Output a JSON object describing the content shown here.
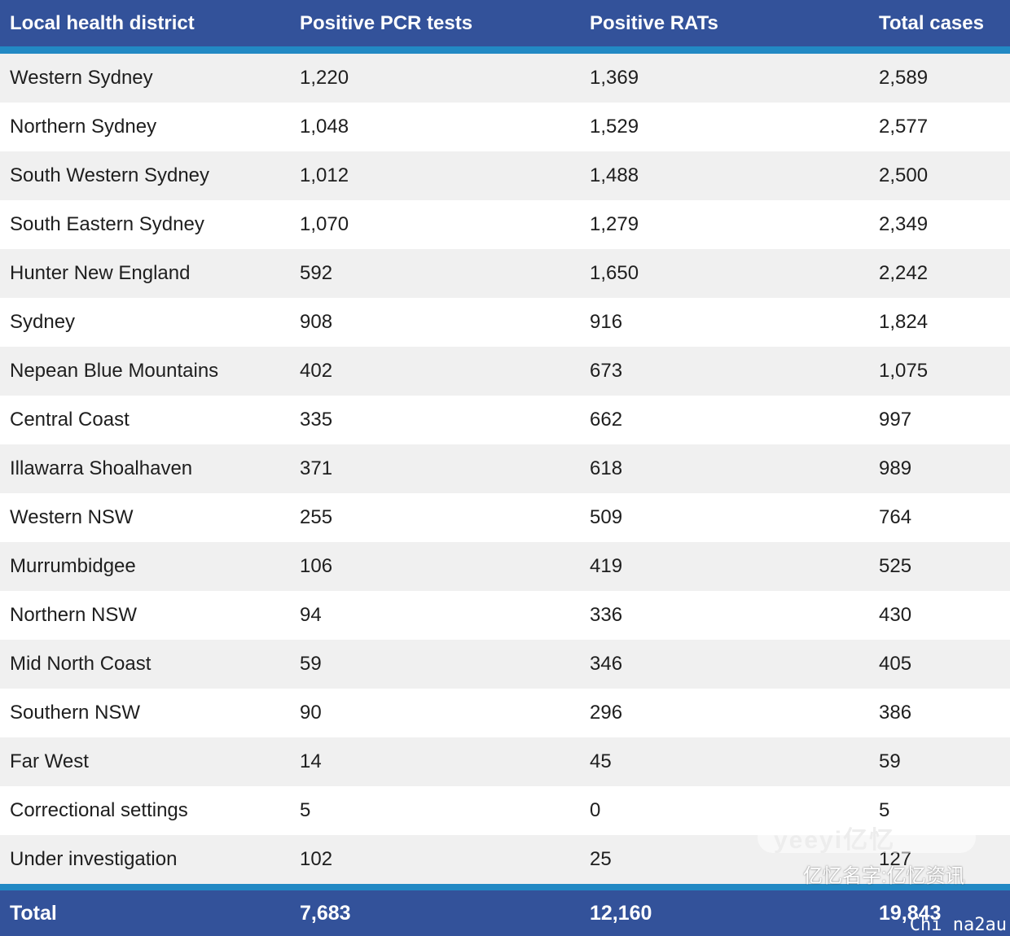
{
  "table": {
    "headers": [
      "Local health district",
      "Positive PCR tests",
      "Positive RATs",
      "Total cases"
    ],
    "rows": [
      [
        "Western Sydney",
        "1,220",
        "1,369",
        "2,589"
      ],
      [
        "Northern Sydney",
        "1,048",
        "1,529",
        "2,577"
      ],
      [
        "South Western Sydney",
        "1,012",
        "1,488",
        "2,500"
      ],
      [
        "South Eastern Sydney",
        "1,070",
        "1,279",
        "2,349"
      ],
      [
        "Hunter New England",
        "592",
        "1,650",
        "2,242"
      ],
      [
        "Sydney",
        "908",
        "916",
        "1,824"
      ],
      [
        "Nepean Blue Mountains",
        "402",
        "673",
        "1,075"
      ],
      [
        "Central Coast",
        "335",
        "662",
        "997"
      ],
      [
        "Illawarra Shoalhaven",
        "371",
        "618",
        "989"
      ],
      [
        "Western NSW",
        "255",
        "509",
        "764"
      ],
      [
        "Murrumbidgee",
        "106",
        "419",
        "525"
      ],
      [
        "Northern NSW",
        "94",
        "336",
        "430"
      ],
      [
        "Mid North Coast",
        "59",
        "346",
        "405"
      ],
      [
        "Southern NSW",
        "90",
        "296",
        "386"
      ],
      [
        "Far West",
        "14",
        "45",
        "59"
      ],
      [
        "Correctional settings",
        "5",
        "0",
        "5"
      ],
      [
        "Under investigation",
        "102",
        "25",
        "127"
      ]
    ],
    "total": [
      "Total",
      "7,683",
      "12,160",
      "19,843"
    ]
  },
  "watermark": {
    "badge": "yeeyi亿忆",
    "text": "亿忆名字:亿忆资讯",
    "corner": "Chi na2au"
  },
  "colors": {
    "header_bg": "#33529a",
    "stripe": "#2289c4",
    "row_alt": "#f0f0f0"
  }
}
